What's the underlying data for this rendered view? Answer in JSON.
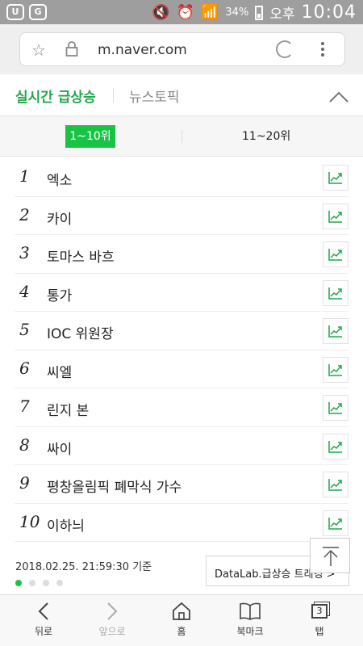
{
  "status_bar": {
    "battery_pct": "34%",
    "ampm": "오후",
    "time": "10:04"
  },
  "browser": {
    "url": "m.naver.com"
  },
  "header": {
    "tab_realtime": "실시간 급상승",
    "tab_news": "뉴스토픽"
  },
  "range": {
    "first": "1~10위",
    "second": "11~20위"
  },
  "keywords": [
    {
      "rank": "1",
      "text": "엑소"
    },
    {
      "rank": "2",
      "text": "카이"
    },
    {
      "rank": "3",
      "text": "토마스 바흐"
    },
    {
      "rank": "4",
      "text": "통가"
    },
    {
      "rank": "5",
      "text": "IOC 위원장"
    },
    {
      "rank": "6",
      "text": "씨엘"
    },
    {
      "rank": "7",
      "text": "린지 본"
    },
    {
      "rank": "8",
      "text": "싸이"
    },
    {
      "rank": "9",
      "text": "평창올림픽 폐막식 가수"
    },
    {
      "rank": "10",
      "text": "이하늬"
    }
  ],
  "footer": {
    "timestamp": "2018.02.25. 21:59:30 기준",
    "datalab": "DataLab.급상승 트래킹 >"
  },
  "bottom_nav": {
    "back": "뒤로",
    "forward": "앞으로",
    "home": "홈",
    "bookmark": "북마크",
    "tabs": "탭",
    "tab_count": "3"
  },
  "colors": {
    "accent_green": "#19c445",
    "trend_green": "#1fa948"
  }
}
